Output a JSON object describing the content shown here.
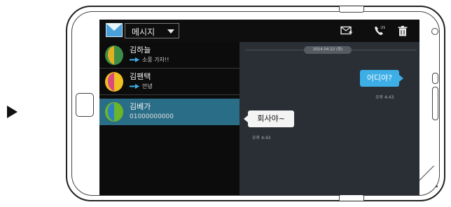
{
  "app": {
    "title": "메시지",
    "icon": "envelope-icon",
    "toolbar_icons": [
      "new-message-icon",
      "call-icon",
      "trash-icon"
    ],
    "colors": {
      "accent": "#3daee6",
      "selected_row": "#2a6d87",
      "header_bg": "#0e0e0e",
      "list_bg": "#0c0c0c",
      "conversation_bg": "#2a2f35"
    }
  },
  "conversations": [
    {
      "name": "김하늘",
      "preview": "소풍 가자!!",
      "avatar_color": "#e0b020",
      "avatar_bg": "#3c8d45",
      "has_forward_icon": true
    },
    {
      "name": "김팬택",
      "preview": "안녕",
      "avatar_color": "#d84b7c",
      "avatar_bg": "#f0c020",
      "has_forward_icon": true
    },
    {
      "name": "김베가",
      "preview": "01000000000",
      "avatar_color": "#2e7fbf",
      "avatar_bg": "#6bb52a",
      "has_forward_icon": false
    }
  ],
  "thread": {
    "date": "2014.04.22 (화)",
    "messages": [
      {
        "direction": "out",
        "text": "어디야?",
        "time": "오후 4:43"
      },
      {
        "direction": "in",
        "text": "회사야~",
        "time": "오후 4:43"
      }
    ]
  }
}
